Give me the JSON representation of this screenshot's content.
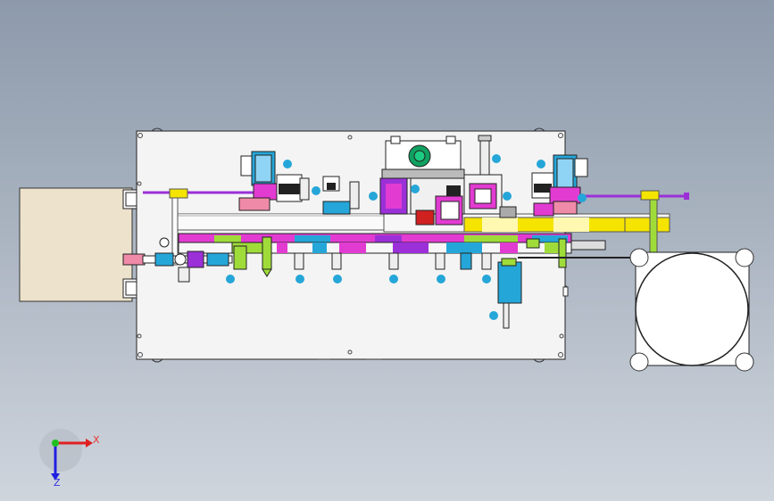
{
  "viewport": {
    "background_top": "#8d9aab",
    "background_bottom": "#cfd5dd"
  },
  "triad": {
    "x_label": "X",
    "z_label": "Z",
    "x_color": "#e02020",
    "y_color": "#20c020",
    "z_color": "#2020e0"
  },
  "model": {
    "plate_color": "#f4f4f4",
    "box_color": "#ede3cc",
    "accent_cyan": "#25a6d8",
    "accent_magenta": "#e23bd1",
    "accent_yellow": "#f4e400",
    "accent_purple": "#9b30d8",
    "accent_lime": "#9fdc3a"
  }
}
